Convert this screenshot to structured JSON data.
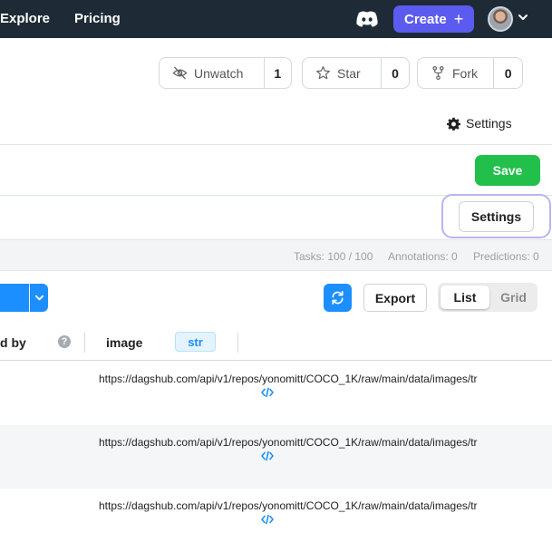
{
  "nav": {
    "explore": "Explore",
    "pricing": "Pricing",
    "create_label": "Create",
    "create_plus": "+"
  },
  "repo_actions": {
    "unwatch_label": "Unwatch",
    "unwatch_count": "1",
    "star_label": "Star",
    "star_count": "0",
    "fork_label": "Fork",
    "fork_count": "0"
  },
  "settings_link": "Settings",
  "save_label": "Save",
  "settings_button": "Settings",
  "stats": {
    "tasks": "Tasks: 100 / 100",
    "annotations": "Annotations: 0",
    "predictions": "Predictions: 0"
  },
  "toolbar": {
    "export_label": "Export",
    "list_label": "List",
    "grid_label": "Grid"
  },
  "columns": {
    "partial_label": "d by",
    "image_label": "image",
    "image_type": "str",
    "help": "?"
  },
  "rows": [
    {
      "text": "https://dagshub.com/api/v1/repos/yonomitt/COCO_1K/raw/main/data/images/tr"
    },
    {
      "text": "https://dagshub.com/api/v1/repos/yonomitt/COCO_1K/raw/main/data/images/tr"
    },
    {
      "text": "https://dagshub.com/api/v1/repos/yonomitt/COCO_1K/raw/main/data/images/tr"
    }
  ],
  "colors": {
    "topbar": "#1e2b36",
    "create": "#5b5bf0",
    "save": "#22c04b",
    "primary": "#1b8fff",
    "focus_ring": "#b9b5ee"
  }
}
